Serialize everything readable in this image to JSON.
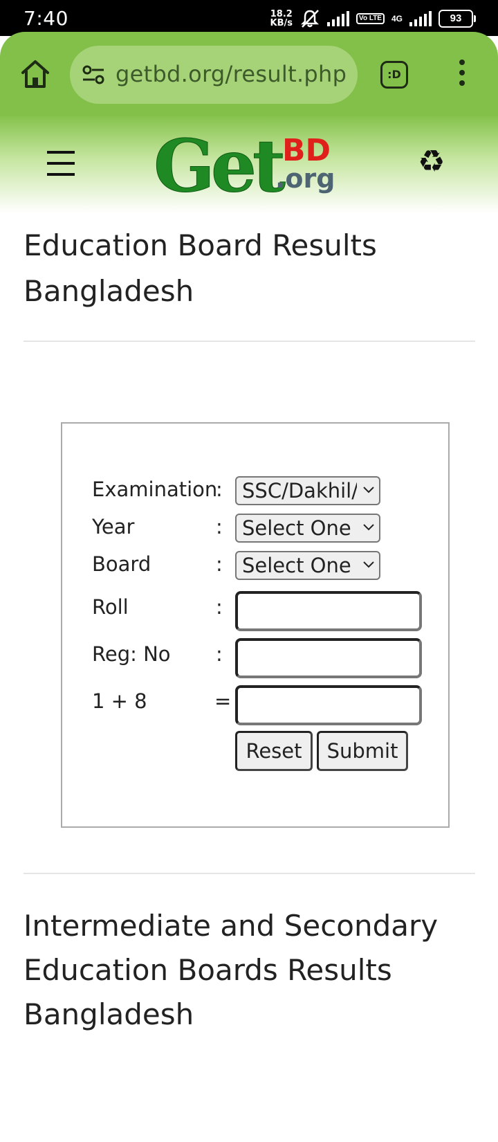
{
  "status_bar": {
    "time": "7:40",
    "net_speed_value": "18.2",
    "net_speed_unit": "KB/s",
    "volte": "Vo LTE",
    "network": "4G",
    "battery": "93"
  },
  "browser": {
    "url": "getbd.org/result.php",
    "tabs_label": ":D"
  },
  "site": {
    "logo_get": "Get",
    "logo_bd": "BD",
    "logo_org": ".org"
  },
  "page": {
    "title": "Education Board Results Bangladesh",
    "footer_title": "Intermediate and Secondary Education Boards Results Bangladesh"
  },
  "form": {
    "examination": {
      "label": "Examination",
      "colon": ":",
      "value": "SSC/Dakhil/"
    },
    "year": {
      "label": "Year",
      "colon": ":",
      "value": "Select One"
    },
    "board": {
      "label": "Board",
      "colon": ":",
      "value": "Select One"
    },
    "roll": {
      "label": "Roll",
      "colon": ":",
      "value": ""
    },
    "reg_no": {
      "label": "Reg: No",
      "colon": ":",
      "value": ""
    },
    "captcha": {
      "label": "1 + 8",
      "colon": "=",
      "value": ""
    },
    "reset_label": "Reset",
    "submit_label": "Submit"
  }
}
